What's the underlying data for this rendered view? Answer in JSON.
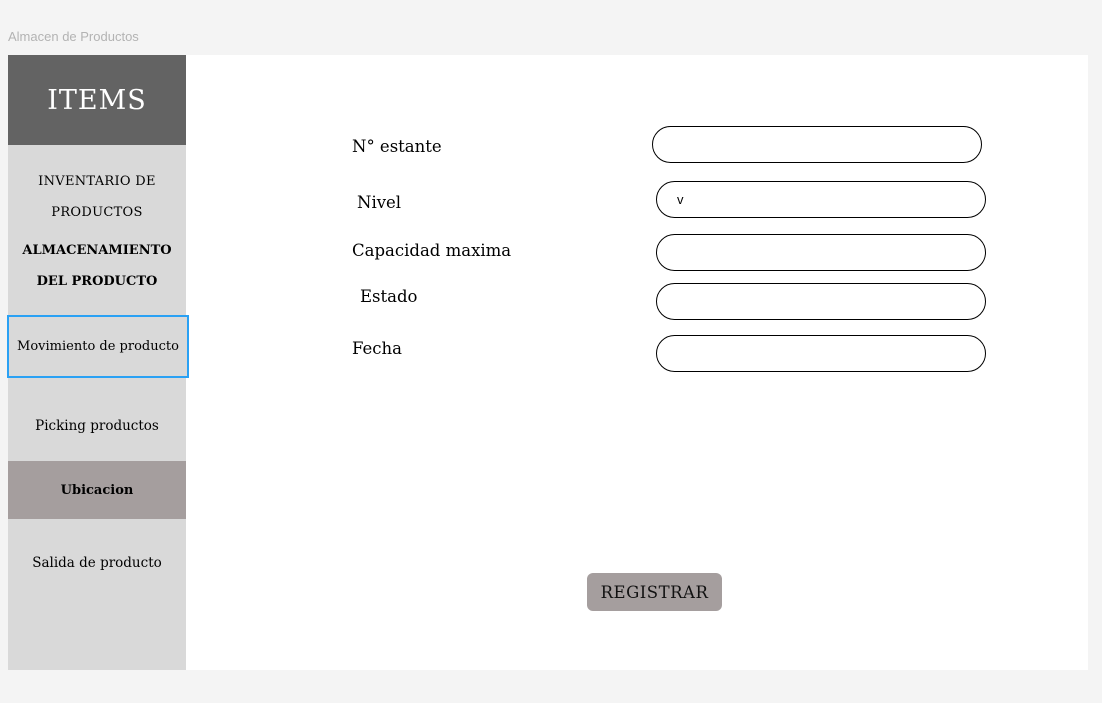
{
  "window": {
    "title": "Almacen de Productos"
  },
  "sidebar": {
    "header": "ITEMS",
    "items": [
      {
        "label": "INVENTARIO DE PRODUCTOS"
      },
      {
        "label_line1": "ALMACENAMIENTO",
        "label_line2": "DEL PRODUCTO"
      },
      {
        "label": "Movimiento de producto"
      },
      {
        "label": "Picking productos"
      },
      {
        "label": "Ubicacion"
      },
      {
        "label": "Salida de producto"
      }
    ]
  },
  "form": {
    "fields": [
      {
        "label": "N° estante",
        "value": ""
      },
      {
        "label": "Nivel",
        "value": "v"
      },
      {
        "label": "Capacidad maxima",
        "value": ""
      },
      {
        "label": "Estado",
        "value": ""
      },
      {
        "label": "Fecha",
        "value": ""
      }
    ],
    "submit_label": "REGISTRAR"
  },
  "colors": {
    "sidebar_bg": "#d9d9d9",
    "header_bg": "#636363",
    "selected_item_bg": "#a59e9e",
    "focus_border": "#2aa1f4",
    "button_bg": "#a59e9e"
  }
}
